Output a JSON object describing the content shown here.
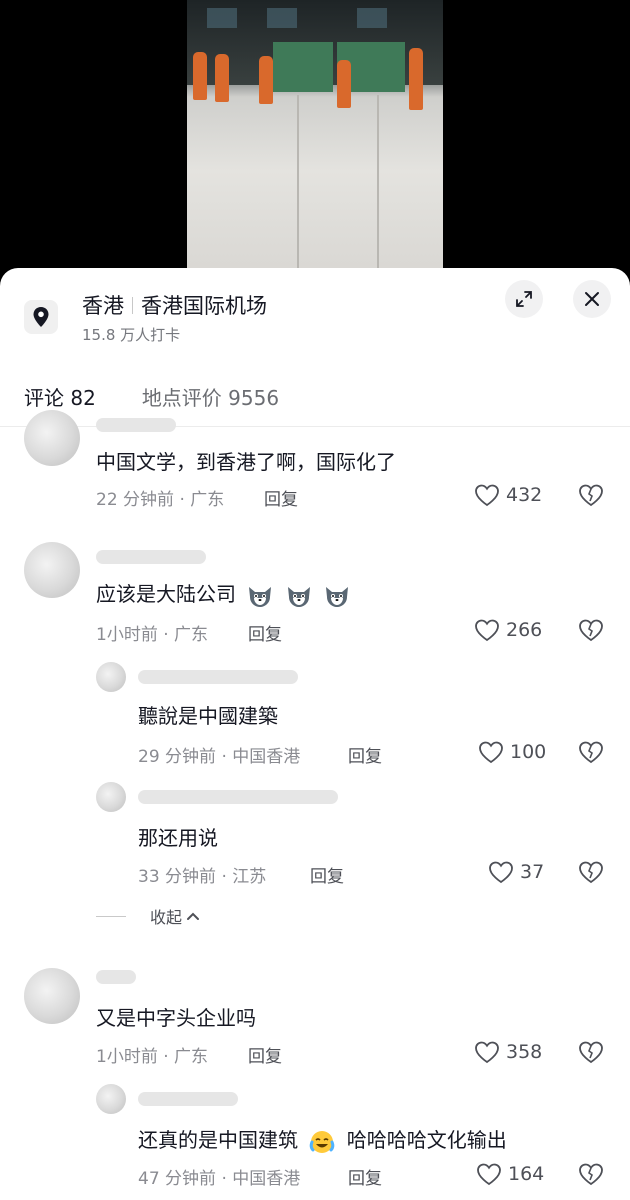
{
  "location": {
    "city": "香港",
    "place": "香港国际机场",
    "checkins": "15.8 万人打卡"
  },
  "tabs": [
    {
      "label": "评论 82",
      "active": true
    },
    {
      "label": "地点评价 9556",
      "active": false
    }
  ],
  "comments": [
    {
      "text": "中国文学，到香港了啊，国际化了",
      "time_region": "22 分钟前 · 广东",
      "reply": "回复",
      "likes": "432"
    },
    {
      "text": "应该是大陆公司",
      "time_region": "1小时前 · 广东",
      "reply": "回复",
      "likes": "266",
      "emoji": "husky-emoji x3"
    },
    {
      "text": "聽說是中國建築",
      "time_region": "29 分钟前 · 中国香港",
      "reply": "回复",
      "likes": "100"
    },
    {
      "text": "那还用说",
      "time_region": "33 分钟前 · 江苏",
      "reply": "回复",
      "likes": "37"
    },
    {
      "text": "又是中字头企业吗",
      "time_region": "1小时前 · 广东",
      "reply": "回复",
      "likes": "358"
    },
    {
      "text_before": "还真的是中国建筑",
      "text_after": "哈哈哈哈文化输出",
      "time_region": "47 分钟前 · 中国香港",
      "reply": "回复",
      "likes": "164",
      "emoji": "crying-laughing-emoji"
    }
  ],
  "collapse_label": "收起",
  "colors": {
    "accent_text": "#161823",
    "meta": "#8a8b91",
    "sheet_bg": "#ffffff",
    "backdrop": "#000000"
  }
}
